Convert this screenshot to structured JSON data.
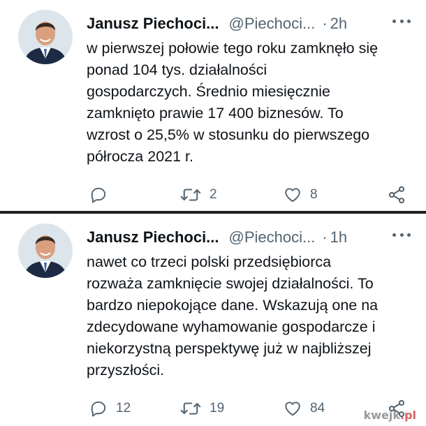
{
  "tweets": [
    {
      "author_name": "Janusz Piechoci...",
      "handle": "@Piechoci...",
      "separator": "·",
      "time": "2h",
      "lines": [
        "w pierwszej połowie tego roku zamknęło się",
        "ponad 104 tys. działalności",
        "gospodarczych. Średnio miesięcznie",
        "zamknięto prawie 17 400 biznesów. To",
        "wzrost o 25,5% w stosunku do pierwszego",
        "półrocza 2021 r."
      ],
      "reply_count": "",
      "retweet_count": "2",
      "like_count": "8"
    },
    {
      "author_name": "Janusz Piechoci...",
      "handle": "@Piechoci...",
      "separator": "·",
      "time": "1h",
      "lines": [
        "nawet co trzeci polski przedsiębiorca",
        "rozważa zamknięcie swojej działalności. To",
        "bardzo niepokojące dane. Wskazują one na",
        "zdecydowane wyhamowanie gospodarcze i",
        "niekorzystną perspektywę już w najbliższej",
        "przyszłości."
      ],
      "reply_count": "12",
      "retweet_count": "19",
      "like_count": "84"
    }
  ],
  "watermark": {
    "main": "kwejk",
    "suffix": ".pl"
  },
  "icons": {
    "reply": "reply-icon",
    "retweet": "retweet-icon",
    "like": "heart-icon",
    "share": "share-icon",
    "more": "more-icon"
  },
  "colors": {
    "text": "#0f1419",
    "secondary": "#536471",
    "divider": "#1f1f1f"
  }
}
